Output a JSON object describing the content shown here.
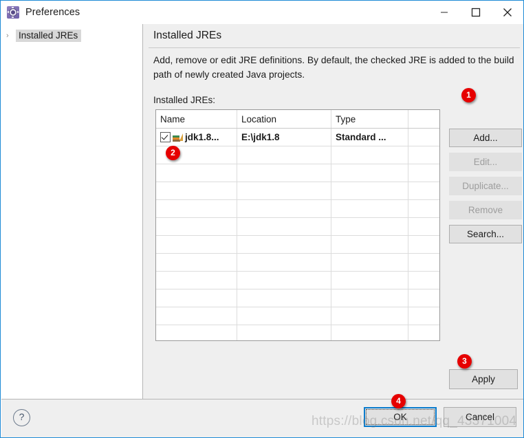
{
  "window": {
    "title": "Preferences",
    "icon": "preferences-gear-icon",
    "accent_color": "#1d8ad6",
    "controls": {
      "minimize": "minimize-icon",
      "maximize": "maximize-icon",
      "close": "close-icon"
    }
  },
  "sidebar": {
    "items": [
      {
        "label": "Installed JREs",
        "arrow": "›",
        "selected": true
      }
    ]
  },
  "content": {
    "page_title": "Installed JREs",
    "description": "Add, remove or edit JRE definitions. By default, the checked JRE is added to the build path of newly created Java projects.",
    "list_label": "Installed JREs:"
  },
  "table": {
    "columns": [
      "Name",
      "Location",
      "Type",
      ""
    ],
    "rows": [
      {
        "checked": true,
        "icon": "jre-library-icon",
        "name": "jdk1.8...",
        "location": "E:\\jdk1.8",
        "type": "Standard ...",
        "extra": ""
      }
    ],
    "empty_row_count": 12
  },
  "buttons": {
    "add": {
      "label": "Add...",
      "enabled": true
    },
    "edit": {
      "label": "Edit...",
      "enabled": false
    },
    "duplicate": {
      "label": "Duplicate...",
      "enabled": false
    },
    "remove": {
      "label": "Remove",
      "enabled": false
    },
    "search": {
      "label": "Search...",
      "enabled": true
    },
    "apply": {
      "label": "Apply",
      "enabled": true
    },
    "ok": {
      "label": "OK",
      "enabled": true,
      "focused": true
    },
    "cancel": {
      "label": "Cancel",
      "enabled": true
    }
  },
  "help": {
    "icon": "question-mark-icon",
    "glyph": "?"
  },
  "annotations": [
    {
      "number": "1"
    },
    {
      "number": "2"
    },
    {
      "number": "3"
    },
    {
      "number": "4"
    }
  ],
  "watermark": {
    "text": "https://blog.csdn.net/qq_43371004"
  }
}
